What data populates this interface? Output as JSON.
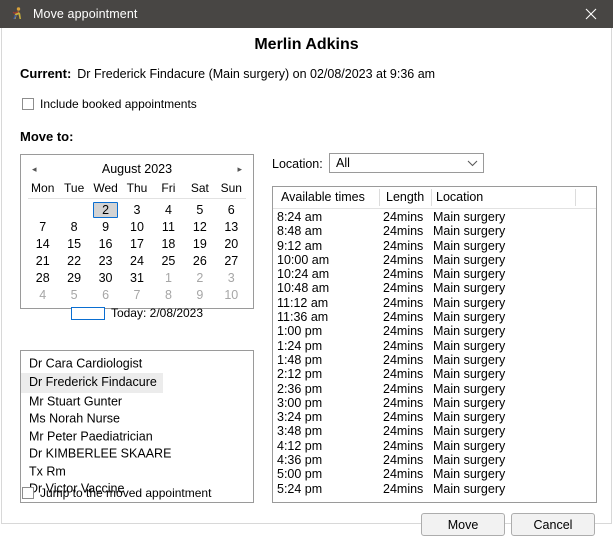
{
  "window": {
    "title": "Move appointment",
    "icon": "runner-icon",
    "close_label": "✕",
    "titlebar_color": "#484644"
  },
  "header": {
    "patient_name": "Merlin Adkins",
    "current_label": "Current:",
    "current_value": "Dr Frederick Findacure (Main surgery) on 02/08/2023 at 9:36 am"
  },
  "options": {
    "include_booked": {
      "label": "Include booked appointments",
      "checked": false
    },
    "jump_to_moved": {
      "label": "Jump to the moved appointment",
      "checked": false
    }
  },
  "move_to": {
    "label": "Move to:"
  },
  "calendar": {
    "prev_arrow": "◂",
    "next_arrow": "▸",
    "title": "August 2023",
    "day_headers": [
      "Mon",
      "Tue",
      "Wed",
      "Thu",
      "Fri",
      "Sat",
      "Sun"
    ],
    "weeks": [
      [
        {
          "d": "",
          "m": "blank"
        },
        {
          "d": "",
          "m": "blank"
        },
        {
          "d": "2",
          "m": "cur",
          "selected": true
        },
        {
          "d": "3",
          "m": "cur"
        },
        {
          "d": "4",
          "m": "cur"
        },
        {
          "d": "5",
          "m": "cur"
        },
        {
          "d": "6",
          "m": "cur"
        }
      ],
      [
        {
          "d": "7",
          "m": "cur"
        },
        {
          "d": "8",
          "m": "cur"
        },
        {
          "d": "9",
          "m": "cur"
        },
        {
          "d": "10",
          "m": "cur"
        },
        {
          "d": "11",
          "m": "cur"
        },
        {
          "d": "12",
          "m": "cur"
        },
        {
          "d": "13",
          "m": "cur"
        }
      ],
      [
        {
          "d": "14",
          "m": "cur"
        },
        {
          "d": "15",
          "m": "cur"
        },
        {
          "d": "16",
          "m": "cur"
        },
        {
          "d": "17",
          "m": "cur"
        },
        {
          "d": "18",
          "m": "cur"
        },
        {
          "d": "19",
          "m": "cur"
        },
        {
          "d": "20",
          "m": "cur"
        }
      ],
      [
        {
          "d": "21",
          "m": "cur"
        },
        {
          "d": "22",
          "m": "cur"
        },
        {
          "d": "23",
          "m": "cur"
        },
        {
          "d": "24",
          "m": "cur"
        },
        {
          "d": "25",
          "m": "cur"
        },
        {
          "d": "26",
          "m": "cur"
        },
        {
          "d": "27",
          "m": "cur"
        }
      ],
      [
        {
          "d": "28",
          "m": "cur"
        },
        {
          "d": "29",
          "m": "cur"
        },
        {
          "d": "30",
          "m": "cur"
        },
        {
          "d": "31",
          "m": "cur"
        },
        {
          "d": "1",
          "m": "other"
        },
        {
          "d": "2",
          "m": "other"
        },
        {
          "d": "3",
          "m": "other"
        }
      ],
      [
        {
          "d": "4",
          "m": "other"
        },
        {
          "d": "5",
          "m": "other"
        },
        {
          "d": "6",
          "m": "other"
        },
        {
          "d": "7",
          "m": "other"
        },
        {
          "d": "8",
          "m": "other"
        },
        {
          "d": "9",
          "m": "other"
        },
        {
          "d": "10",
          "m": "other"
        }
      ]
    ],
    "today_label": "Today: 2/08/2023"
  },
  "practitioners": {
    "selected": "Dr Frederick Findacure",
    "items": [
      "Dr Cara Cardiologist",
      "Dr Frederick Findacure",
      "Mr Stuart Gunter",
      "Ms Norah Nurse",
      "Mr Peter Paediatrician",
      "Dr KIMBERLEE SKAARE",
      "Tx Rm",
      "Dr Victor Vaccine"
    ]
  },
  "location_filter": {
    "label": "Location:",
    "value": "All",
    "chevron": "chevron-down-icon"
  },
  "times_table": {
    "columns": [
      "Available times",
      "Length",
      "Location"
    ],
    "rows": [
      [
        "8:24 am",
        "24mins",
        "Main surgery"
      ],
      [
        "8:48 am",
        "24mins",
        "Main surgery"
      ],
      [
        "9:12 am",
        "24mins",
        "Main surgery"
      ],
      [
        "10:00 am",
        "24mins",
        "Main surgery"
      ],
      [
        "10:24 am",
        "24mins",
        "Main surgery"
      ],
      [
        "10:48 am",
        "24mins",
        "Main surgery"
      ],
      [
        "11:12 am",
        "24mins",
        "Main surgery"
      ],
      [
        "11:36 am",
        "24mins",
        "Main surgery"
      ],
      [
        "1:00 pm",
        "24mins",
        "Main surgery"
      ],
      [
        "1:24 pm",
        "24mins",
        "Main surgery"
      ],
      [
        "1:48 pm",
        "24mins",
        "Main surgery"
      ],
      [
        "2:12 pm",
        "24mins",
        "Main surgery"
      ],
      [
        "2:36 pm",
        "24mins",
        "Main surgery"
      ],
      [
        "3:00 pm",
        "24mins",
        "Main surgery"
      ],
      [
        "3:24 pm",
        "24mins",
        "Main surgery"
      ],
      [
        "3:48 pm",
        "24mins",
        "Main surgery"
      ],
      [
        "4:12 pm",
        "24mins",
        "Main surgery"
      ],
      [
        "4:36 pm",
        "24mins",
        "Main surgery"
      ],
      [
        "5:00 pm",
        "24mins",
        "Main surgery"
      ],
      [
        "5:24 pm",
        "24mins",
        "Main surgery"
      ]
    ]
  },
  "footer": {
    "move_label": "Move",
    "cancel_label": "Cancel"
  },
  "colors": {
    "titlebar": "#484644",
    "selection_border": "#0a6ed1",
    "selection_fill": "#d3d3d3",
    "list_selection": "#ececec"
  }
}
